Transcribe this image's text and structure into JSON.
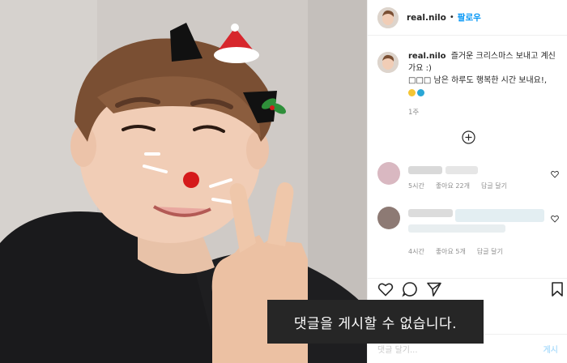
{
  "post": {
    "username": "real.nilo",
    "follow_label": "팔로우",
    "separator": "•"
  },
  "caption": {
    "username": "real.nilo",
    "line1": "즐거운 크리스마스 보내고 계신가요 :)",
    "line2": "□□□ 남은 하루도 행복한 시간 보내요!,",
    "age": "1주"
  },
  "comments": [
    {
      "time": "5시간",
      "likes": "좋아요 22개",
      "reply": "답글 달기"
    },
    {
      "time": "4시간",
      "likes": "좋아요 5개",
      "reply": "답글 달기"
    }
  ],
  "composer": {
    "placeholder": "댓글 달기...",
    "post_label": "게시"
  },
  "toast": {
    "message": "댓글을 게시할 수 없습니다."
  },
  "icons": {
    "like": "heart-icon",
    "comment": "speech-bubble-icon",
    "share": "paper-plane-icon",
    "save": "bookmark-icon",
    "load_more": "plus-circle-icon"
  },
  "colors": {
    "link": "#0095f6",
    "toast_bg": "#262626",
    "muted": "#8e8e8e"
  }
}
